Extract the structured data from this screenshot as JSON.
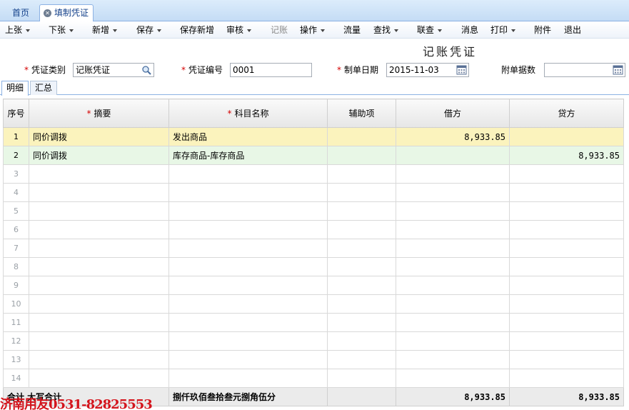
{
  "tabs": {
    "home": "首页",
    "active": "填制凭证"
  },
  "toolbar": [
    {
      "label": "上张",
      "caret": true,
      "disabled": false
    },
    {
      "label": "下张",
      "caret": true,
      "disabled": false
    },
    {
      "label": "新增",
      "caret": true,
      "disabled": false
    },
    {
      "label": "保存",
      "caret": true,
      "disabled": false
    },
    {
      "label": "保存新增",
      "caret": false,
      "disabled": false
    },
    {
      "label": "审核",
      "caret": true,
      "disabled": false
    },
    {
      "label": "记账",
      "caret": false,
      "disabled": true
    },
    {
      "label": "操作",
      "caret": true,
      "disabled": false
    },
    {
      "label": "流量",
      "caret": false,
      "disabled": false
    },
    {
      "label": "查找",
      "caret": true,
      "disabled": false
    },
    {
      "label": "联查",
      "caret": true,
      "disabled": false
    },
    {
      "label": "消息",
      "caret": false,
      "disabled": false
    },
    {
      "label": "打印",
      "caret": true,
      "disabled": false
    },
    {
      "label": "附件",
      "caret": false,
      "disabled": false
    },
    {
      "label": "退出",
      "caret": false,
      "disabled": false
    }
  ],
  "voucher": {
    "title": "记账凭证",
    "type_label": "凭证类别",
    "type_value": "记账凭证",
    "no_label": "凭证编号",
    "no_value": "0001",
    "date_label": "制单日期",
    "date_value": "2015-11-03",
    "attach_label": "附单据数",
    "attach_value": ""
  },
  "subtabs": {
    "detail": "明细",
    "summary": "汇总"
  },
  "columns": {
    "seq": "序号",
    "summary": "摘要",
    "account": "科目名称",
    "aux": "辅助项",
    "debit": "借方",
    "credit": "贷方"
  },
  "rows": [
    {
      "num": "1",
      "summary": "同价调拨",
      "account": "发出商品",
      "aux": "",
      "debit": "8,933.85",
      "credit": ""
    },
    {
      "num": "2",
      "summary": "同价调拨",
      "account": "库存商品-库存商品",
      "aux": "",
      "debit": "",
      "credit": "8,933.85"
    },
    {
      "num": "3",
      "summary": "",
      "account": "",
      "aux": "",
      "debit": "",
      "credit": ""
    },
    {
      "num": "4",
      "summary": "",
      "account": "",
      "aux": "",
      "debit": "",
      "credit": ""
    },
    {
      "num": "5",
      "summary": "",
      "account": "",
      "aux": "",
      "debit": "",
      "credit": ""
    },
    {
      "num": "6",
      "summary": "",
      "account": "",
      "aux": "",
      "debit": "",
      "credit": ""
    },
    {
      "num": "7",
      "summary": "",
      "account": "",
      "aux": "",
      "debit": "",
      "credit": ""
    },
    {
      "num": "8",
      "summary": "",
      "account": "",
      "aux": "",
      "debit": "",
      "credit": ""
    },
    {
      "num": "9",
      "summary": "",
      "account": "",
      "aux": "",
      "debit": "",
      "credit": ""
    },
    {
      "num": "10",
      "summary": "",
      "account": "",
      "aux": "",
      "debit": "",
      "credit": ""
    },
    {
      "num": "11",
      "summary": "",
      "account": "",
      "aux": "",
      "debit": "",
      "credit": ""
    },
    {
      "num": "12",
      "summary": "",
      "account": "",
      "aux": "",
      "debit": "",
      "credit": ""
    },
    {
      "num": "13",
      "summary": "",
      "account": "",
      "aux": "",
      "debit": "",
      "credit": ""
    },
    {
      "num": "14",
      "summary": "",
      "account": "",
      "aux": "",
      "debit": "",
      "credit": ""
    }
  ],
  "total": {
    "label": "合计  大写合计",
    "amount_words": "捌仟玖佰叁拾叁元捌角伍分",
    "debit": "8,933.85",
    "credit": "8,933.85"
  },
  "watermark": "济南用友0531-82825553",
  "colors": {
    "required": "#d40000",
    "row1": "#fbf3bd",
    "row2": "#e8f7e6",
    "watermark": "#d4141c"
  }
}
